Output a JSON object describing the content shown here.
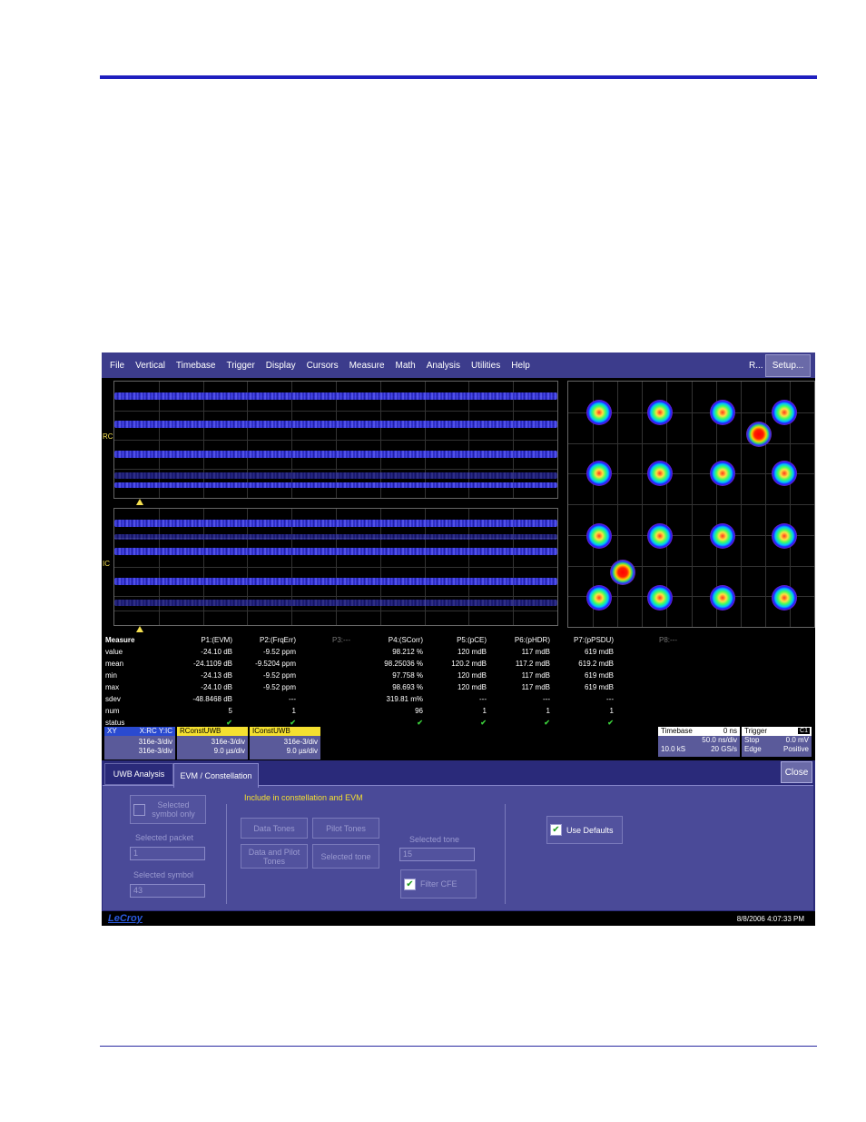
{
  "menubar": {
    "items": [
      "File",
      "Vertical",
      "Timebase",
      "Trigger",
      "Display",
      "Cursors",
      "Measure",
      "Math",
      "Analysis",
      "Utilities",
      "Help"
    ],
    "r_label": "R...",
    "setup_label": "Setup..."
  },
  "traces": {
    "upper_label": "RC",
    "lower_label": "IC"
  },
  "measure": {
    "header": "Measure",
    "columns": [
      "P1:(EVM)",
      "P2:(FrqErr)",
      "P3:---",
      "P4:(SCorr)",
      "P5:(pCE)",
      "P6:(pHDR)",
      "P7:(pPSDU)",
      "P8:---"
    ],
    "rows": [
      {
        "label": "value",
        "cells": [
          "-24.10 dB",
          "-9.52 ppm",
          "",
          "98.212 %",
          "120 mdB",
          "117 mdB",
          "619 mdB",
          ""
        ]
      },
      {
        "label": "mean",
        "cells": [
          "-24.1109 dB",
          "-9.5204 ppm",
          "",
          "98.25036 %",
          "120.2 mdB",
          "117.2 mdB",
          "619.2 mdB",
          ""
        ]
      },
      {
        "label": "min",
        "cells": [
          "-24.13 dB",
          "-9.52 ppm",
          "",
          "97.758 %",
          "120 mdB",
          "117 mdB",
          "619 mdB",
          ""
        ]
      },
      {
        "label": "max",
        "cells": [
          "-24.10 dB",
          "-9.52 ppm",
          "",
          "98.693 %",
          "120 mdB",
          "117 mdB",
          "619 mdB",
          ""
        ]
      },
      {
        "label": "sdev",
        "cells": [
          "-48.8468 dB",
          "---",
          "",
          "319.81 m%",
          "---",
          "---",
          "---",
          ""
        ]
      },
      {
        "label": "num",
        "cells": [
          "5",
          "1",
          "",
          "96",
          "1",
          "1",
          "1",
          ""
        ]
      },
      {
        "label": "status",
        "cells": [
          "✔",
          "✔",
          "",
          "✔",
          "✔",
          "✔",
          "✔",
          ""
        ]
      }
    ]
  },
  "channels": [
    {
      "name": "XY",
      "src": "X:RC Y:IC",
      "l1": "316e-3/div",
      "l2": "316e-3/div",
      "color": "#2a4ad0",
      "text": "#fff"
    },
    {
      "name": "RConstUWB",
      "src": "",
      "l1": "316e-3/div",
      "l2": "9.0 µs/div",
      "color": "#f5e030",
      "text": "#000"
    },
    {
      "name": "IConstUWB",
      "src": "",
      "l1": "316e-3/div",
      "l2": "9.0 µs/div",
      "color": "#f5e030",
      "text": "#000"
    }
  ],
  "timebase": {
    "title": "Timebase",
    "offset": "0 ns",
    "tdiv": "50.0 ns/div",
    "samples": "10.0 kS",
    "rate": "20 GS/s"
  },
  "trigger": {
    "title": "Trigger",
    "channel": "C1",
    "mode": "Stop",
    "level": "0.0 mV",
    "type": "Edge",
    "slope": "Positive"
  },
  "dialog": {
    "tabs": [
      "UWB Analysis",
      "EVM / Constellation"
    ],
    "close_label": "Close",
    "selected_symbol_only": "Selected symbol only",
    "selected_packet_label": "Selected packet",
    "selected_packet_value": "1",
    "selected_symbol_label": "Selected symbol",
    "selected_symbol_value": "43",
    "include_heading": "Include in constellation and EVM",
    "data_tones": "Data Tones",
    "pilot_tones": "Pilot Tones",
    "data_and_pilot_tones": "Data and Pilot Tones",
    "selected_tone_btn": "Selected tone",
    "selected_tone_label": "Selected tone",
    "selected_tone_value": "15",
    "filter_cfe": "Filter CFE",
    "use_defaults": "Use Defaults"
  },
  "status": {
    "logo": "LeCroy",
    "datetime": "8/8/2006 4:07:33 PM"
  }
}
